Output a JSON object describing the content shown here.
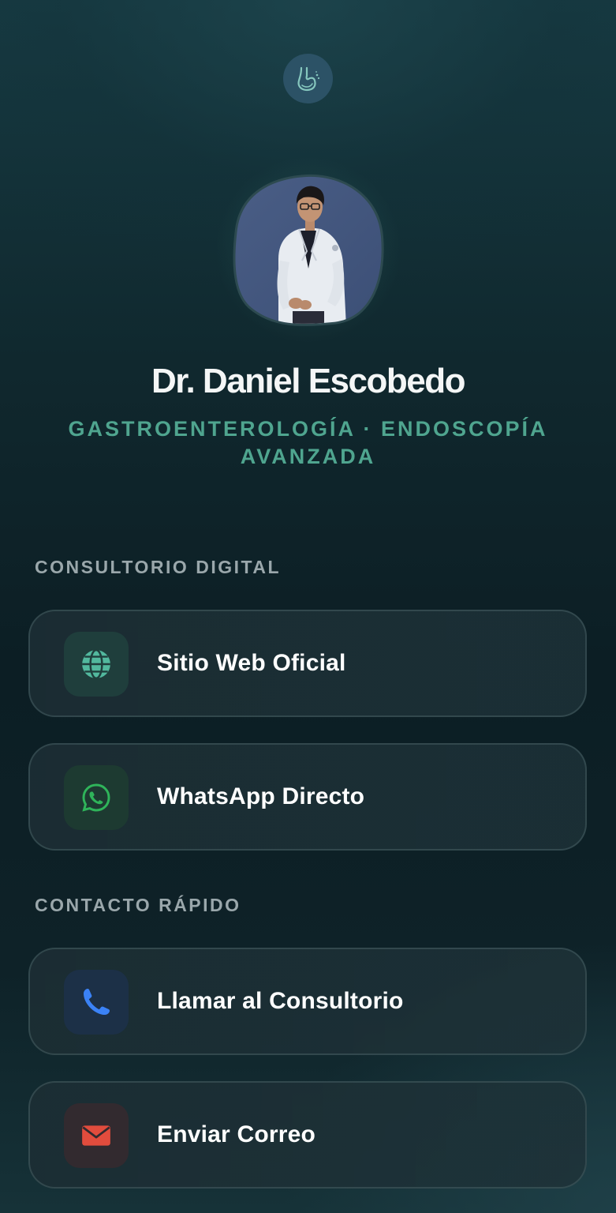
{
  "header": {
    "logo_icon": "stomach-logo-icon"
  },
  "profile": {
    "photo": "doctor-portrait",
    "name": "Dr. Daniel Escobedo",
    "specialty_line1": "GASTROENTEROLOGÍA · ENDOSCOPÍA",
    "specialty_line2": "AVANZADA"
  },
  "sections": [
    {
      "title": "CONSULTORIO DIGITAL",
      "links": [
        {
          "label": "Sitio Web Oficial",
          "icon": "globe-icon",
          "color": "#52b89e"
        },
        {
          "label": "WhatsApp Directo",
          "icon": "whatsapp-icon",
          "color": "#2fb45a"
        }
      ]
    },
    {
      "title": "CONTACTO RÁPIDO",
      "links": [
        {
          "label": "Llamar al Consultorio",
          "icon": "phone-icon",
          "color": "#3b82f6"
        },
        {
          "label": "Enviar Correo",
          "icon": "mail-icon",
          "color": "#e24c3d"
        }
      ]
    }
  ],
  "colors": {
    "accent": "#4fa58f",
    "section_title": "#9aa7ab",
    "background": "#0f252b"
  }
}
